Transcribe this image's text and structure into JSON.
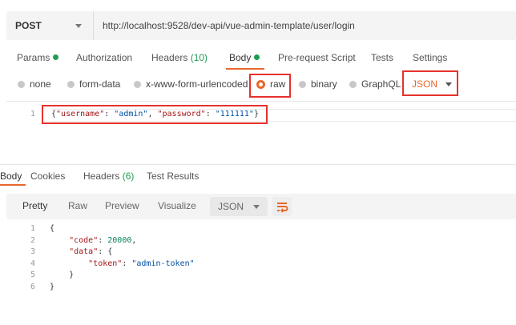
{
  "request": {
    "method": "POST",
    "url": "http://localhost:9528/dev-api/vue-admin-template/user/login"
  },
  "request_tabs": {
    "params": "Params",
    "authorization": "Authorization",
    "headers": "Headers",
    "headers_count": "(10)",
    "body": "Body",
    "prerequest": "Pre-request Script",
    "tests": "Tests",
    "settings": "Settings"
  },
  "body_types": {
    "none": "none",
    "form_data": "form-data",
    "urlencoded": "x-www-form-urlencoded",
    "raw": "raw",
    "binary": "binary",
    "graphql": "GraphQL",
    "format": "JSON"
  },
  "editor": {
    "line_numbers": [
      "1"
    ],
    "lines": [
      [
        {
          "t": "{",
          "c": ""
        },
        {
          "t": "\"username\"",
          "c": "k"
        },
        {
          "t": ": ",
          "c": ""
        },
        {
          "t": "\"admin\"",
          "c": "s"
        },
        {
          "t": ", ",
          "c": ""
        },
        {
          "t": "\"password\"",
          "c": "k"
        },
        {
          "t": ": ",
          "c": ""
        },
        {
          "t": "\"111111\"",
          "c": "s"
        },
        {
          "t": "}",
          "c": ""
        }
      ]
    ]
  },
  "response_tabs": {
    "body": "Body",
    "cookies": "Cookies",
    "headers": "Headers",
    "headers_count": "(6)",
    "test_results": "Test Results"
  },
  "response_toolbar": {
    "pretty": "Pretty",
    "raw": "Raw",
    "preview": "Preview",
    "visualize": "Visualize",
    "format": "JSON"
  },
  "response": {
    "line_numbers": [
      "1",
      "2",
      "3",
      "4",
      "5",
      "6"
    ],
    "lines": [
      [
        {
          "t": "{",
          "c": ""
        }
      ],
      [
        {
          "t": "    ",
          "c": ""
        },
        {
          "t": "\"code\"",
          "c": "k"
        },
        {
          "t": ": ",
          "c": ""
        },
        {
          "t": "20000",
          "c": "n"
        },
        {
          "t": ",",
          "c": ""
        }
      ],
      [
        {
          "t": "    ",
          "c": ""
        },
        {
          "t": "\"data\"",
          "c": "k"
        },
        {
          "t": ": {",
          "c": ""
        }
      ],
      [
        {
          "t": "        ",
          "c": ""
        },
        {
          "t": "\"token\"",
          "c": "k"
        },
        {
          "t": ": ",
          "c": ""
        },
        {
          "t": "\"admin-token\"",
          "c": "s"
        }
      ],
      [
        {
          "t": "    }",
          "c": ""
        }
      ],
      [
        {
          "t": "}",
          "c": ""
        }
      ]
    ]
  },
  "colors": {
    "accent": "#e8672b",
    "highlight_box": "#e5322d",
    "status_green": "#1f9d55"
  }
}
